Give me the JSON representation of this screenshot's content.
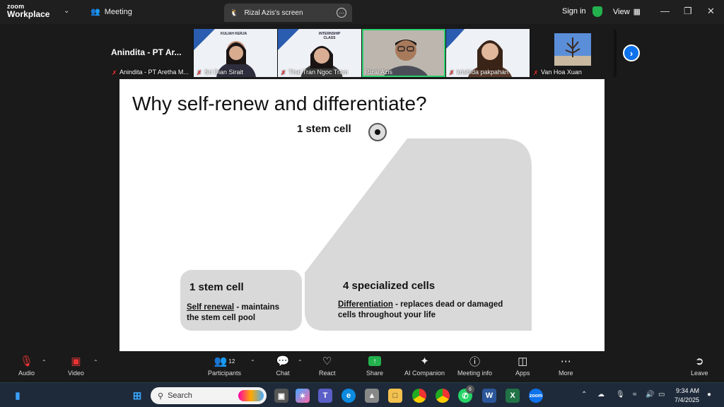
{
  "titlebar": {
    "logo_top": "zoom",
    "logo_bottom": "Workplace",
    "meeting_label": "Meeting",
    "screen_tab_label": "Rizal Azis's screen",
    "signin_label": "Sign in",
    "view_label": "View"
  },
  "participants_strip": [
    {
      "name": "Anindita - PT Aretha M...",
      "big_name": "Anindita - PT Ar..."
    },
    {
      "name": "Sri Dian Sirait",
      "slide_text": "KULIAH KERJA"
    },
    {
      "name": "Thai Tran Ngoc Tram",
      "slide_text": "INTERNSHIP CLASS"
    },
    {
      "name": "Rizal Azis"
    },
    {
      "name": "krishida pakpahan"
    },
    {
      "name": "Van Hoa Xuan"
    }
  ],
  "slide": {
    "title": "Why self-renew and differentiate?",
    "top_label": "1 stem cell",
    "left_box": {
      "heading": "1 stem cell",
      "term": "Self renewal",
      "desc_rest": " - maintains",
      "desc_line2": "the stem cell pool"
    },
    "right_box": {
      "heading": "4 specialized cells",
      "term": "Differentiation",
      "desc_rest": " - replaces dead or damaged",
      "desc_line2": "cells throughout your life"
    }
  },
  "toolbar": {
    "audio": "Audio",
    "video": "Video",
    "participants": "Participants",
    "participants_count": "12",
    "chat": "Chat",
    "react": "React",
    "share": "Share",
    "ai_companion": "AI Companion",
    "meeting_info": "Meeting info",
    "apps": "Apps",
    "more": "More",
    "leave": "Leave"
  },
  "taskbar": {
    "search_placeholder": "Search",
    "whatsapp_badge": "6",
    "time": "9:34 AM",
    "date": "7/4/2025"
  },
  "colors": {
    "accent_blue": "#0e72ed",
    "active_green": "#2ed06e",
    "shape_grey": "#d9d9d9"
  }
}
